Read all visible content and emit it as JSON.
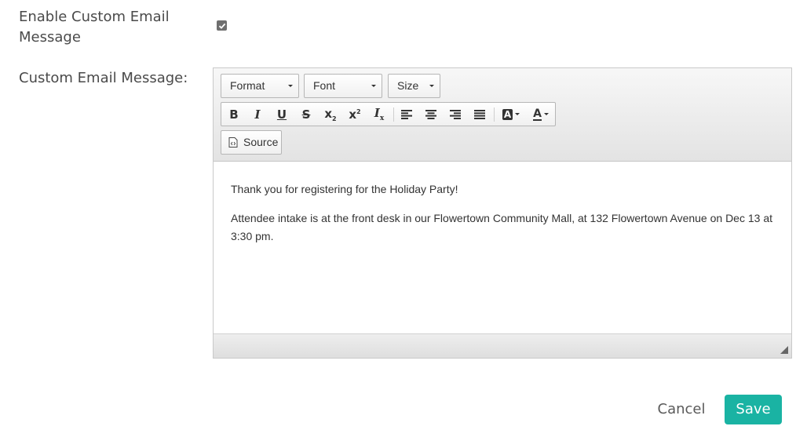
{
  "form": {
    "enable_label": "Enable Custom Email Message",
    "enable_checked": true,
    "custom_label": "Custom Email Message:"
  },
  "editor": {
    "format_label": "Format",
    "font_label": "Font",
    "size_label": "Size",
    "source_label": "Source",
    "buttons": {
      "bold": "B",
      "italic": "I",
      "underline": "U",
      "strike": "S",
      "subscript": "x",
      "superscript": "x",
      "remove_format": "I",
      "bg_color": "A",
      "text_color": "A"
    },
    "paragraphs": [
      "Thank you for registering for the Holiday Party!",
      "Attendee intake is at the front desk in our Flowertown Community Mall, at 132 Flowertown Avenue on Dec 13 at 3:30 pm."
    ]
  },
  "actions": {
    "cancel_label": "Cancel",
    "save_label": "Save"
  },
  "colors": {
    "accent": "#1ab3a3"
  }
}
